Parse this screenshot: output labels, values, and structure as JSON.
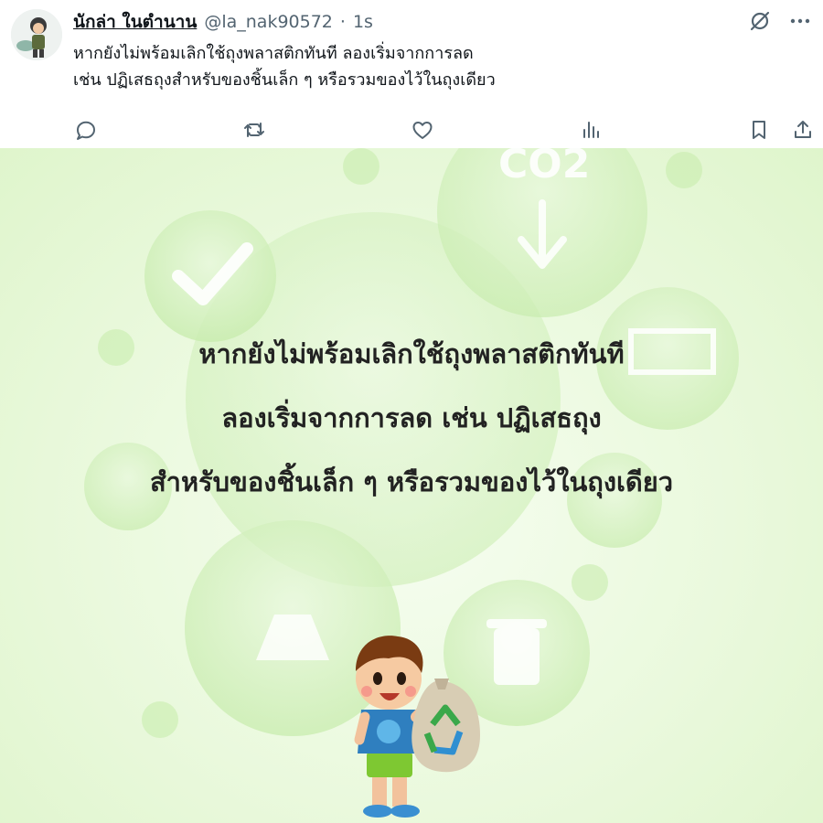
{
  "post": {
    "author": {
      "display_name": "นักล่า ในตำนาน",
      "handle": "@la_nak90572",
      "separator": "·",
      "time": "1s"
    },
    "text_line_1": "หากยังไม่พร้อมเลิกใช้ถุงพลาสติกทันที ลองเริ่มจากการลด",
    "text_line_2": "เช่น ปฏิเสธถุงสำหรับของชิ้นเล็ก ๆ หรือรวมของไว้ในถุงเดียว",
    "icons": {
      "top": [
        "grok-icon",
        "more-icon"
      ],
      "actions": [
        "reply-icon",
        "retweet-icon",
        "like-icon",
        "views-icon",
        "bookmark-icon",
        "share-icon"
      ]
    }
  },
  "media": {
    "line_1": "หากยังไม่พร้อมเลิกใช้ถุงพลาสติกทันที",
    "line_2": "ลองเริ่มจากการลด เช่น ปฏิเสธถุง",
    "line_3": "สำหรับของชิ้นเล็ก ๆ หรือรวมของไว้ในถุงเดียว",
    "colors": {
      "background": "#eaf9dd",
      "bubble": "#c9ecb0",
      "text": "#222222"
    }
  }
}
